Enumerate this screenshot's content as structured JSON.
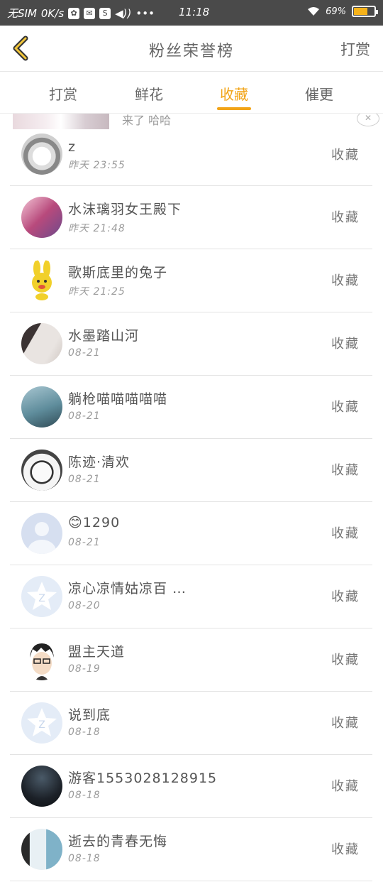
{
  "status_bar": {
    "carrier": "无SIM",
    "speed": "0K/s",
    "time": "11:18",
    "battery_percent": "69%",
    "battery_level": 0.69,
    "accent": "#f6b21a"
  },
  "header": {
    "title": "粉丝荣誉榜",
    "action_label": "打赏",
    "back_icon": "chevron-left-icon"
  },
  "tabs": [
    {
      "label": "打赏",
      "active": false
    },
    {
      "label": "鲜花",
      "active": false
    },
    {
      "label": "收藏",
      "active": true
    },
    {
      "label": "催更",
      "active": false
    }
  ],
  "peek_item": {
    "text": "来了 哈哈"
  },
  "fans": [
    {
      "name": "z",
      "time": "昨天  23:55",
      "action": "收藏"
    },
    {
      "name": "水沫璃羽女王殿下",
      "time": "昨天  21:48",
      "action": "收藏"
    },
    {
      "name": "歌斯底里的兔子",
      "time": "昨天  21:25",
      "action": "收藏"
    },
    {
      "name": "水墨踏山河",
      "time": "08-21",
      "action": "收藏"
    },
    {
      "name": "躺枪喵喵喵喵喵",
      "time": "08-21",
      "action": "收藏"
    },
    {
      "name": "陈迹·清欢",
      "time": "08-21",
      "action": "收藏"
    },
    {
      "name": "😊1290",
      "time": "08-21",
      "action": "收藏"
    },
    {
      "name": "凉心凉情姑凉百 …",
      "time": "08-20",
      "action": "收藏"
    },
    {
      "name": "盟主天道",
      "time": "08-19",
      "action": "收藏"
    },
    {
      "name": "说到底",
      "time": "08-18",
      "action": "收藏"
    },
    {
      "name": "游客1553028128915",
      "time": "08-18",
      "action": "收藏"
    },
    {
      "name": "逝去的青春无悔",
      "time": "08-18",
      "action": "收藏"
    }
  ]
}
